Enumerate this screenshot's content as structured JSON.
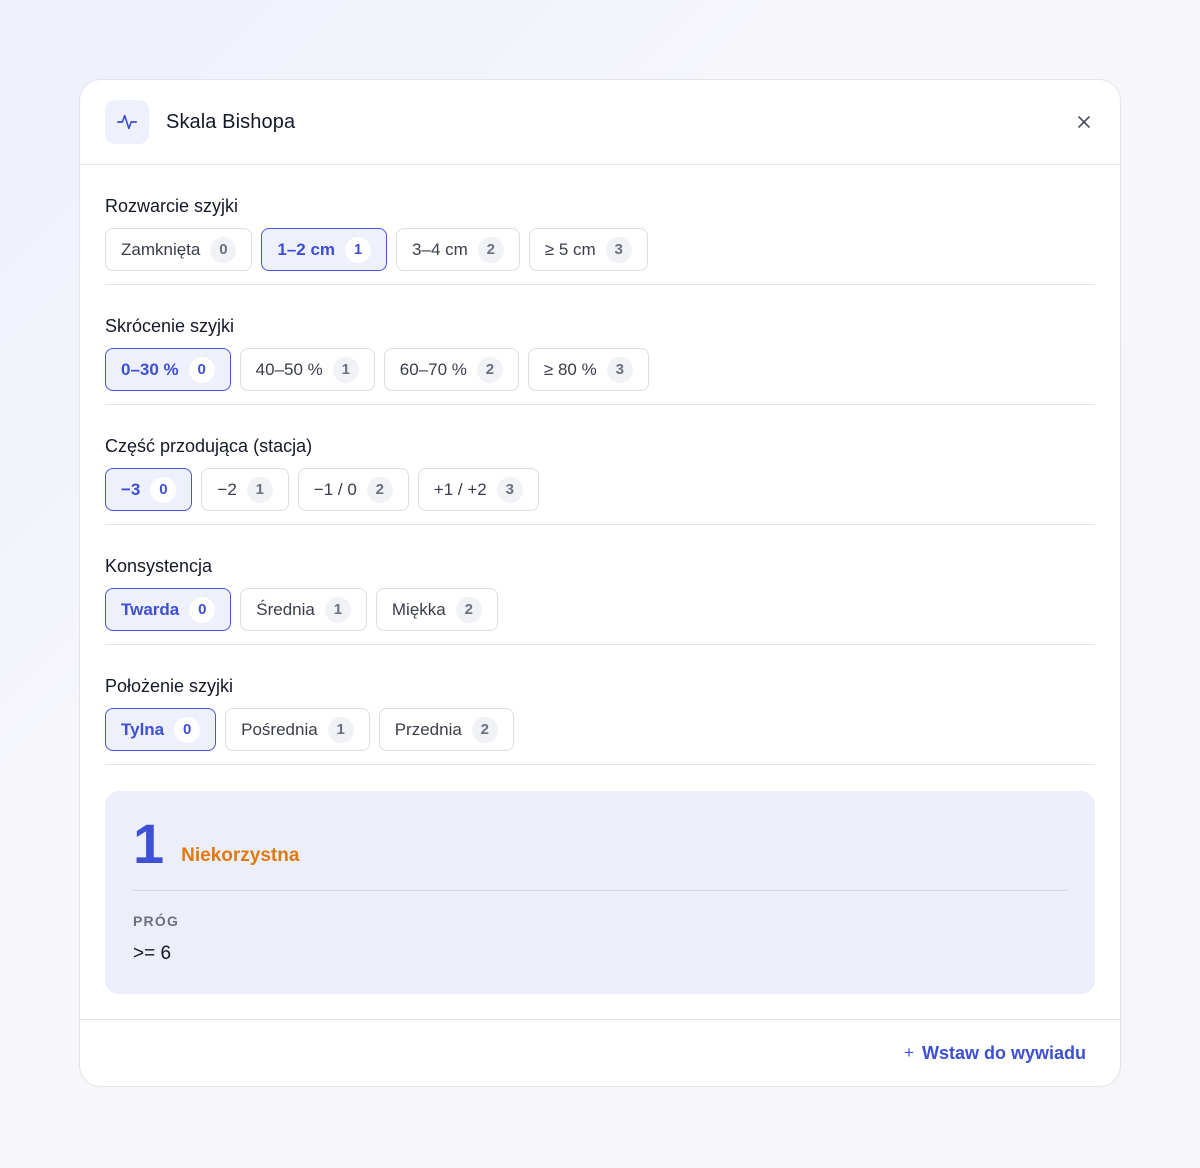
{
  "header": {
    "title": "Skala Bishopa",
    "icon": "activity-icon"
  },
  "sections": [
    {
      "label": "Rozwarcie szyjki",
      "options": [
        {
          "label": "Zamknięta",
          "score": "0",
          "selected": false
        },
        {
          "label": "1–2 cm",
          "score": "1",
          "selected": true
        },
        {
          "label": "3–4 cm",
          "score": "2",
          "selected": false
        },
        {
          "label": "≥ 5 cm",
          "score": "3",
          "selected": false
        }
      ]
    },
    {
      "label": "Skrócenie szyjki",
      "options": [
        {
          "label": "0–30 %",
          "score": "0",
          "selected": true
        },
        {
          "label": "40–50 %",
          "score": "1",
          "selected": false
        },
        {
          "label": "60–70 %",
          "score": "2",
          "selected": false
        },
        {
          "label": "≥ 80 %",
          "score": "3",
          "selected": false
        }
      ]
    },
    {
      "label": "Część przodująca (stacja)",
      "options": [
        {
          "label": "−3",
          "score": "0",
          "selected": true
        },
        {
          "label": "−2",
          "score": "1",
          "selected": false
        },
        {
          "label": "−1 / 0",
          "score": "2",
          "selected": false
        },
        {
          "label": "+1 / +2",
          "score": "3",
          "selected": false
        }
      ]
    },
    {
      "label": "Konsystencja",
      "options": [
        {
          "label": "Twarda",
          "score": "0",
          "selected": true
        },
        {
          "label": "Średnia",
          "score": "1",
          "selected": false
        },
        {
          "label": "Miękka",
          "score": "2",
          "selected": false
        }
      ]
    },
    {
      "label": "Położenie szyjki",
      "options": [
        {
          "label": "Tylna",
          "score": "0",
          "selected": true
        },
        {
          "label": "Pośrednia",
          "score": "1",
          "selected": false
        },
        {
          "label": "Przednia",
          "score": "2",
          "selected": false
        }
      ]
    }
  ],
  "result": {
    "score": "1",
    "verdict": "Niekorzystna",
    "threshold_label": "PRÓG",
    "threshold_value": ">= 6"
  },
  "footer": {
    "insert_label": "Wstaw do wywiadu",
    "insert_icon": "plus-icon"
  },
  "colors": {
    "accent": "#3d4fd2",
    "verdict": "#e07a10",
    "result_bg": "#eceefa"
  }
}
